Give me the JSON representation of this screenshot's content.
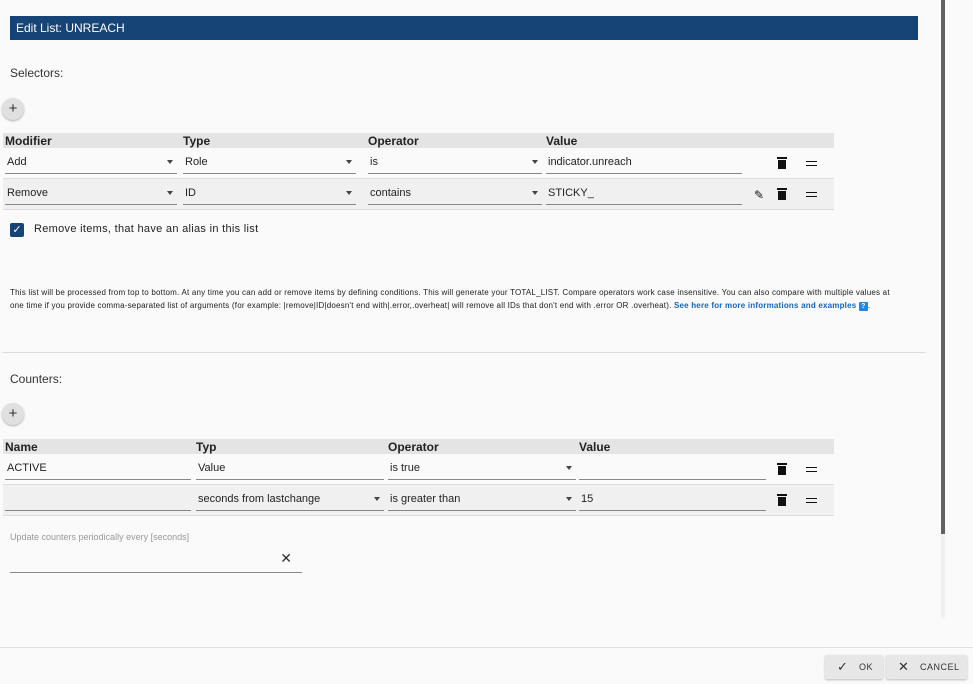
{
  "dialog": {
    "title": "Edit List: UNREACH"
  },
  "selectors": {
    "label": "Selectors:",
    "add_icon": "plus-icon",
    "columns": [
      "Modifier",
      "Type",
      "Operator",
      "Value"
    ],
    "rows": [
      {
        "modifier": "Add",
        "type": "Role",
        "operator": "is",
        "value": "indicator.unreach"
      },
      {
        "modifier": "Remove",
        "type": "ID",
        "operator": "contains",
        "value": "STICKY_"
      }
    ]
  },
  "alias_checkbox": {
    "checked": true,
    "label": "Remove items, that have an alias in this list"
  },
  "help": {
    "text": "This list will be processed from top to bottom. At any time you can add or remove items by defining conditions. This will generate your TOTAL_LIST. Compare operators work case insensitive. You can also compare with multiple values at one time if you provide comma-separated list of arguments (for example: |remove|ID|doesn't end with|.error,.overheat| will remove all IDs that don't end with .error OR .overheat).",
    "link_text": "See here for more informations and examples",
    "link_icon": "question-icon",
    "suffix": "."
  },
  "counters": {
    "label": "Counters:",
    "columns": [
      "Name",
      "Typ",
      "Operator",
      "Value"
    ],
    "rows": [
      {
        "name": "ACTIVE",
        "type": "Value",
        "operator": "is true",
        "value": ""
      },
      {
        "name": "",
        "type": "seconds from lastchange",
        "operator": "is greater than",
        "value": "15"
      }
    ],
    "update_label": "Update counters periodically every [seconds]",
    "update_value": ""
  },
  "footer": {
    "ok_label": "OK",
    "cancel_label": "CANCEL"
  }
}
